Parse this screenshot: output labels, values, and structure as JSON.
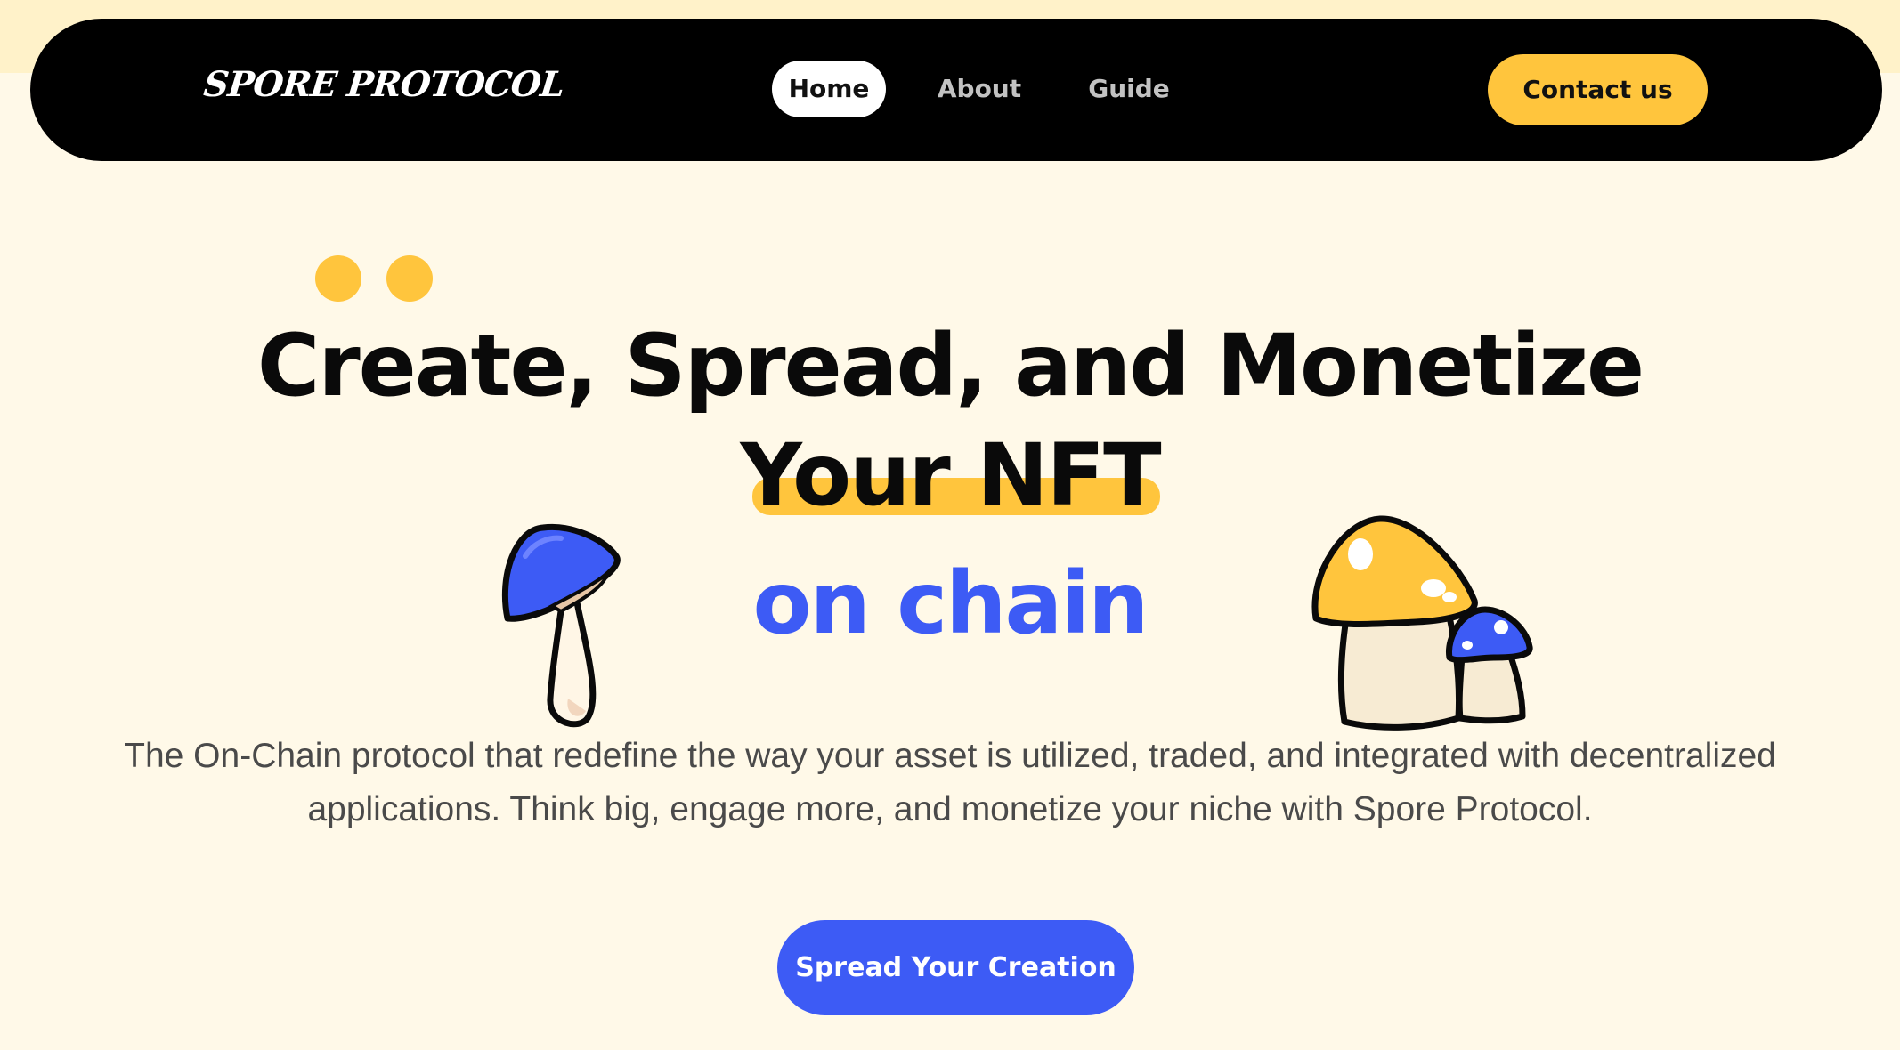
{
  "nav": {
    "logo": "SPORE PROTOCOL",
    "items": [
      {
        "label": "Home",
        "active": true
      },
      {
        "label": "About",
        "active": false
      },
      {
        "label": "Guide",
        "active": false
      }
    ],
    "contact_label": "Contact us"
  },
  "hero": {
    "headline_line1": "Create, Spread, and Monetize",
    "headline_line2": "Your NFT",
    "headline_line3": "on chain",
    "subtitle": "The On-Chain protocol that redefine the way your asset is utilized, traded, and integrated with decentralized applications. Think big, engage more, and monetize your niche with Spore Protocol.",
    "cta_label": "Spread Your Creation"
  },
  "colors": {
    "background": "#FFF9E8",
    "navbar": "#000000",
    "accent_yellow": "#FFC53D",
    "accent_blue": "#3D5BF5"
  },
  "icons": [
    "blue-mushroom-icon",
    "yellow-blue-mushrooms-icon",
    "decorative-dots"
  ]
}
